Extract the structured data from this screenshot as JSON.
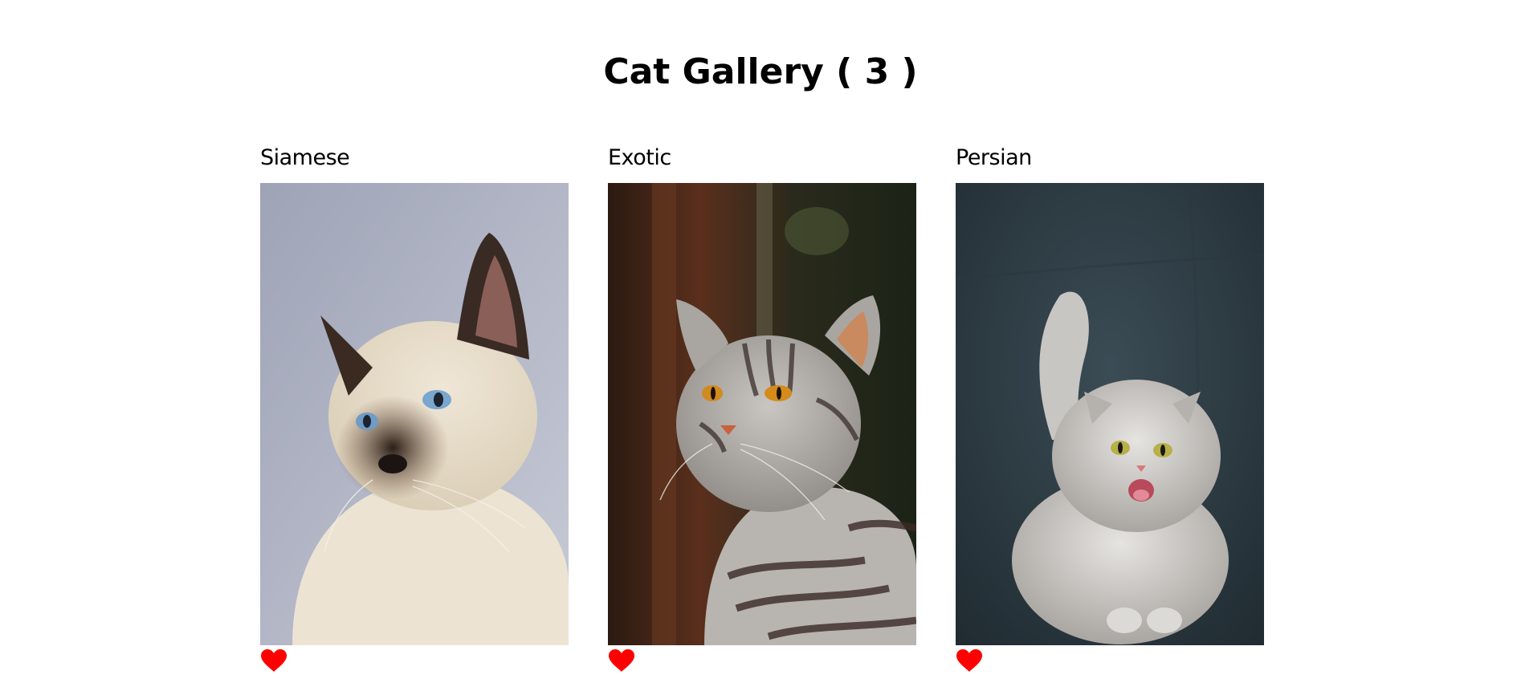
{
  "page": {
    "title": "Cat Gallery ( 3 )"
  },
  "cats": [
    {
      "breed": "Siamese",
      "favorite_icon": "heart-icon",
      "favorite_color": "#ff0000"
    },
    {
      "breed": "Exotic",
      "favorite_icon": "heart-icon",
      "favorite_color": "#ff0000"
    },
    {
      "breed": "Persian",
      "favorite_icon": "heart-icon",
      "favorite_color": "#ff0000"
    }
  ]
}
